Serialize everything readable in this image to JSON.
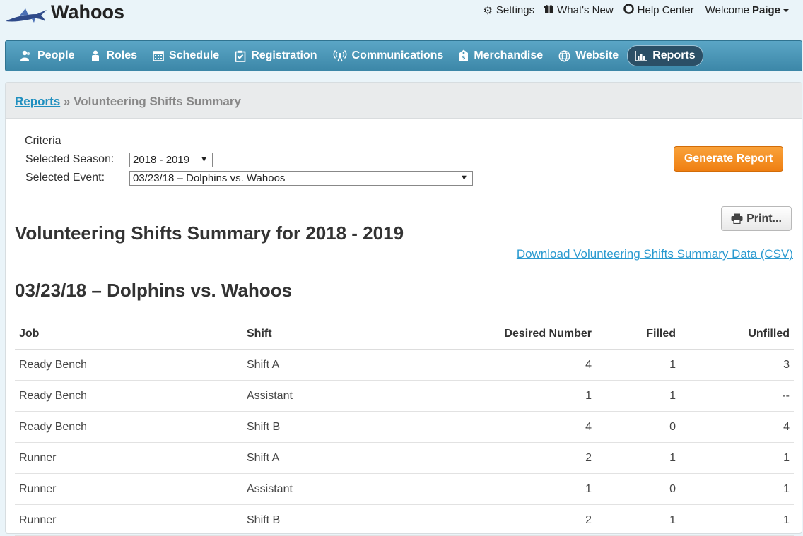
{
  "header": {
    "app_title": "Wahoos",
    "links": [
      {
        "label": "Settings",
        "icon": "gear-icon"
      },
      {
        "label": "What's New",
        "icon": "gift-icon"
      },
      {
        "label": "Help Center",
        "icon": "lifebuoy-icon"
      }
    ],
    "welcome_prefix": "Welcome",
    "user_name": "Paige"
  },
  "nav": {
    "items": [
      {
        "label": "People",
        "icon": "people-icon"
      },
      {
        "label": "Roles",
        "icon": "roles-icon"
      },
      {
        "label": "Schedule",
        "icon": "calendar-icon"
      },
      {
        "label": "Registration",
        "icon": "clipboard-check-icon"
      },
      {
        "label": "Communications",
        "icon": "broadcast-icon"
      },
      {
        "label": "Merchandise",
        "icon": "tag-icon"
      },
      {
        "label": "Website",
        "icon": "globe-icon"
      },
      {
        "label": "Reports",
        "icon": "bar-chart-icon",
        "active": true
      }
    ]
  },
  "breadcrumb": {
    "parent": "Reports",
    "separator": "»",
    "current": "Volunteering Shifts Summary"
  },
  "criteria": {
    "heading": "Criteria",
    "season_label": "Selected Season:",
    "season_value": "2018 - 2019",
    "event_label": "Selected Event:",
    "event_value": "03/23/18 – Dolphins vs. Wahoos"
  },
  "buttons": {
    "generate": "Generate Report",
    "print": "Print..."
  },
  "report": {
    "title": "Volunteering Shifts Summary for 2018 - 2019",
    "csv_link": "Download Volunteering Shifts Summary Data (CSV)",
    "event_title": "03/23/18 – Dolphins vs. Wahoos",
    "columns": [
      "Job",
      "Shift",
      "Desired Number",
      "Filled",
      "Unfilled"
    ],
    "rows": [
      [
        "Ready Bench",
        "Shift A",
        "4",
        "1",
        "3"
      ],
      [
        "Ready Bench",
        "Assistant",
        "1",
        "1",
        "--"
      ],
      [
        "Ready Bench",
        "Shift B",
        "4",
        "0",
        "4"
      ],
      [
        "Runner",
        "Shift A",
        "2",
        "1",
        "1"
      ],
      [
        "Runner",
        "Assistant",
        "1",
        "0",
        "1"
      ],
      [
        "Runner",
        "Shift B",
        "2",
        "1",
        "1"
      ]
    ]
  },
  "colors": {
    "nav_bg": "#4a97b8",
    "nav_active": "#2b4f66",
    "link": "#1f8fbf",
    "generate_btn": "#f28a1c"
  }
}
